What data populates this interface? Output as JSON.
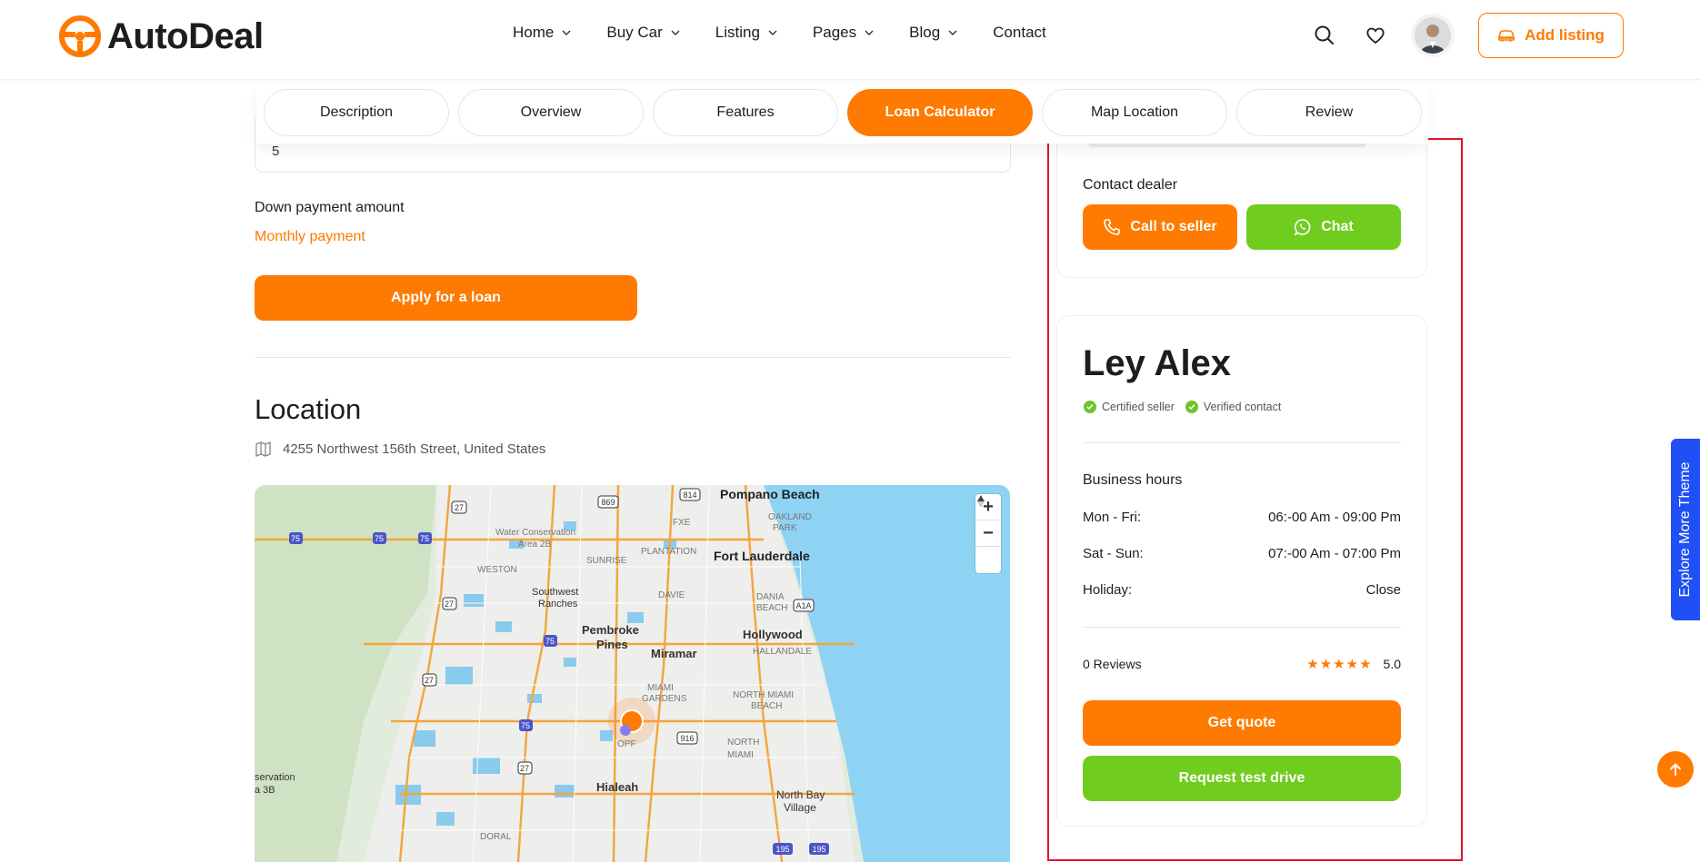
{
  "brand": {
    "name": "AutoDeal",
    "accent": "#ff7a00",
    "green": "#70cc1d"
  },
  "nav": {
    "items": [
      {
        "label": "Home",
        "has_dropdown": true
      },
      {
        "label": "Buy Car",
        "has_dropdown": true
      },
      {
        "label": "Listing",
        "has_dropdown": true
      },
      {
        "label": "Pages",
        "has_dropdown": true
      },
      {
        "label": "Blog",
        "has_dropdown": true
      },
      {
        "label": "Contact",
        "has_dropdown": false
      }
    ],
    "add_listing": "Add listing",
    "icons": [
      "search-icon",
      "heart-icon",
      "avatar"
    ]
  },
  "tabs": [
    {
      "label": "Description",
      "active": false
    },
    {
      "label": "Overview",
      "active": false
    },
    {
      "label": "Features",
      "active": false
    },
    {
      "label": "Loan Calculator",
      "active": true
    },
    {
      "label": "Map Location",
      "active": false
    },
    {
      "label": "Review",
      "active": false
    }
  ],
  "loan": {
    "field_value": "5",
    "down_payment_label": "Down payment amount",
    "monthly_payment_label": "Monthly payment",
    "apply_button": "Apply for a loan"
  },
  "location": {
    "title": "Location",
    "address": "4255 Northwest 156th Street, United States",
    "map": {
      "labels": {
        "pompano": "Pompano Beach",
        "fort_lauderdale": "Fort Lauderdale",
        "hollywood": "Hollywood",
        "pembroke": "Pembroke",
        "pines": "Pines",
        "miramar": "Miramar",
        "hialeah": "Hialeah",
        "north_bay": "North Bay",
        "village": "Village",
        "southwest": "Southwest",
        "ranches": "Ranches",
        "weston": "WESTON",
        "plantation": "PLANTATION",
        "sunrise": "SUNRISE",
        "davie": "DAVIE",
        "dania": "DANIA",
        "beach": "BEACH",
        "hallandale": "HALLANDALE",
        "north_miami_beach": "NORTH MIAMI",
        "north_miami_beach_2": "BEACH",
        "miami_gardens": "MIAMI",
        "gardens": "GARDENS",
        "north": "NORTH",
        "miami": "MIAMI",
        "doral": "DORAL",
        "oakland": "OAKLAND",
        "park": "PARK",
        "water_conservation": "Water Conservation",
        "area_2b": "Area 2B",
        "reservation": "servation",
        "area_3b": "a 3B",
        "opf": "OPF",
        "fxe": "FXE"
      },
      "shields": [
        "27",
        "869",
        "814",
        "75",
        "75",
        "75",
        "27",
        "75",
        "27",
        "75",
        "27",
        "916",
        "A1A",
        "195",
        "195"
      ],
      "zoom_in": "+",
      "zoom_out": "−"
    }
  },
  "contact": {
    "title": "Contact dealer",
    "call_button": "Call to seller",
    "chat_button": "Chat"
  },
  "seller": {
    "name": "Ley Alex",
    "badges": [
      "Certified seller",
      "Verified contact"
    ],
    "hours_title": "Business hours",
    "hours": [
      {
        "day": "Mon - Fri:",
        "time": "06:-00 Am - 09:00 Pm"
      },
      {
        "day": "Sat - Sun:",
        "time": "07:-00 Am - 07:00 Pm"
      },
      {
        "day": "Holiday:",
        "time": "Close"
      }
    ],
    "reviews_label": "0 Reviews",
    "rating": "5.0",
    "stars": 5,
    "quote_button": "Get quote",
    "drive_button": "Request test drive"
  },
  "side_widget": {
    "label": "Explore More Theme",
    "color": "#1f4ff5"
  }
}
